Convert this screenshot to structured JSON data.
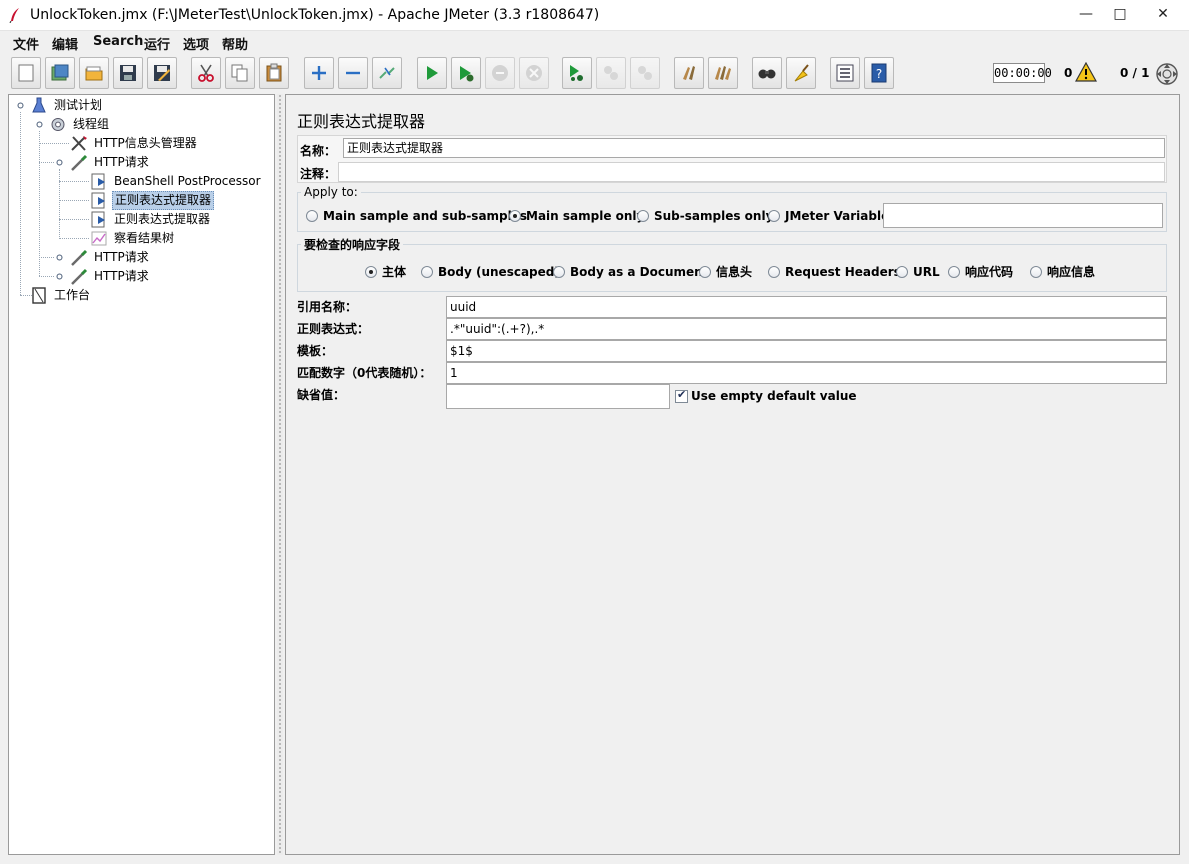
{
  "window": {
    "title": "UnlockToken.jmx (F:\\JMeterTest\\UnlockToken.jmx) - Apache JMeter (3.3 r1808647)",
    "minimize": "—",
    "maximize": "□",
    "close": "✕"
  },
  "menu": [
    "文件",
    "编辑",
    "Search",
    "运行",
    "选项",
    "帮助"
  ],
  "toolbar": {
    "buttons": [
      "new-icon",
      "templates-icon",
      "open-icon",
      "save-icon",
      "save-as-icon",
      "cut-icon",
      "copy-icon",
      "paste-icon",
      "expand-icon",
      "collapse-icon",
      "toggle-icon",
      "start-icon",
      "start-no-pause-icon",
      "stop-icon",
      "shutdown-icon",
      "remote-start-icon",
      "remote-stop-icon",
      "remote-shutdown-icon",
      "clear-icon",
      "clear-all-icon",
      "search-icon",
      "reset-search-icon",
      "function-helper-icon",
      "help-icon"
    ],
    "timer": "00:00:00",
    "error_count": "0",
    "threads": "0 / 1"
  },
  "tree": {
    "nodes": [
      {
        "label": "测试计划",
        "icon": "test-plan-icon"
      },
      {
        "label": "线程组",
        "icon": "thread-group-icon"
      },
      {
        "label": "HTTP信息头管理器",
        "icon": "header-manager-icon"
      },
      {
        "label": "HTTP请求",
        "icon": "http-sampler-icon"
      },
      {
        "label": "BeanShell PostProcessor",
        "icon": "postprocessor-icon"
      },
      {
        "label": "正则表达式提取器",
        "icon": "postprocessor-icon",
        "selected": true
      },
      {
        "label": "正则表达式提取器",
        "icon": "postprocessor-icon"
      },
      {
        "label": "察看结果树",
        "icon": "listener-icon"
      },
      {
        "label": "HTTP请求",
        "icon": "http-sampler-icon"
      },
      {
        "label": "HTTP请求",
        "icon": "http-sampler-icon"
      },
      {
        "label": "工作台",
        "icon": "workbench-icon"
      }
    ]
  },
  "panel": {
    "title": "正则表达式提取器",
    "name_label": "名称：",
    "name_value": "正则表达式提取器",
    "comment_label": "注释：",
    "comment_value": "",
    "apply_to": {
      "title": "Apply to:",
      "options": [
        "Main sample and sub-samples",
        "Main sample only",
        "Sub-samples only",
        "JMeter Variable"
      ],
      "selected": "Main sample only",
      "variable_value": ""
    },
    "field_to_check": {
      "title": "要检查的响应字段",
      "options": [
        "主体",
        "Body (unescaped)",
        "Body as a Document",
        "信息头",
        "Request Headers",
        "URL",
        "响应代码",
        "响应信息"
      ],
      "selected": "主体"
    },
    "ref_name_label": "引用名称：",
    "ref_name_value": "uuid",
    "regex_label": "正则表达式：",
    "regex_value": ".*\"uuid\":(.+?),.*",
    "template_label": "模板：",
    "template_value": "$1$",
    "match_no_label": "匹配数字（0代表随机）：",
    "match_no_value": "1",
    "default_label": "缺省值：",
    "default_value": "",
    "use_empty_default_label": "Use empty default value",
    "use_empty_default_checked": true
  }
}
